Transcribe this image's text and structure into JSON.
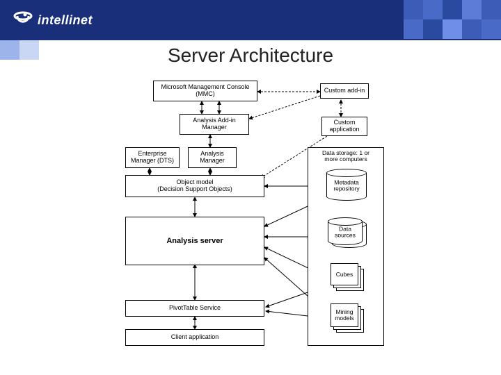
{
  "brand": {
    "name": "intellinet"
  },
  "title": "Server Architecture",
  "boxes": {
    "mmc": "Microsoft Management Console\n(MMC)",
    "custom_addin": "Custom add-in",
    "analysis_addin_manager": "Analysis Add-in\nManager",
    "custom_application": "Custom\napplication",
    "enterprise_manager": "Enterprise\nManager (DTS)",
    "analysis_manager": "Analysis\nManager",
    "object_model": "Object model\n(Decision Support Objects)",
    "analysis_server": "Analysis server",
    "pivot_table_service": "PivotTable Service",
    "client_application": "Client application",
    "data_storage_group": "Data storage: 1 or\nmore computers",
    "metadata_repo": "Metadata\nrepository",
    "data_sources": "Data\nsources",
    "cubes": "Cubes",
    "mining_models": "Mining\nmodels"
  }
}
